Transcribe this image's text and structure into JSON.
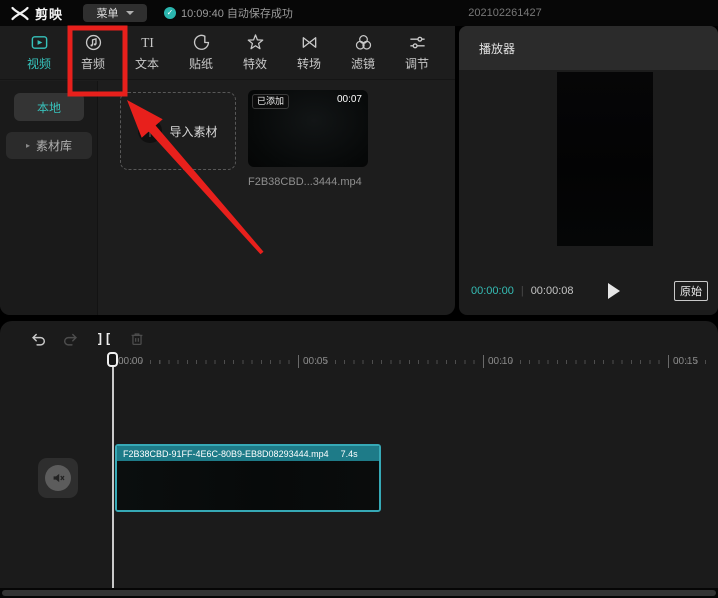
{
  "colors": {
    "accent": "#36c3bc",
    "annotation_red": "#e8201c",
    "clip_header_teal": "#1e7b88"
  },
  "topbar": {
    "app_name": "剪映",
    "menu_label": "菜单",
    "autosave_status": "10:09:40 自动保存成功",
    "project_name": "202102261427"
  },
  "toolbar": {
    "tabs": [
      {
        "label": "视频"
      },
      {
        "label": "音频"
      },
      {
        "label": "文本"
      },
      {
        "label": "贴纸"
      },
      {
        "label": "特效"
      },
      {
        "label": "转场"
      },
      {
        "label": "滤镜"
      },
      {
        "label": "调节"
      }
    ]
  },
  "sidebar": {
    "local_label": "本地",
    "library_label": "素材库"
  },
  "media": {
    "import_label": "导入素材",
    "card": {
      "badge": "已添加",
      "duration": "00:07",
      "name": "F2B38CBD...3444.mp4"
    }
  },
  "player": {
    "title": "播放器",
    "current_time": "00:00:00",
    "time_separator": "|",
    "total_time": "00:00:08",
    "original_label": "原始"
  },
  "timeline": {
    "ruler_labels": [
      "00:00",
      "00:05",
      "00:10",
      "00:15"
    ],
    "clip": {
      "name": "F2B38CBD-91FF-4E6C-80B9-EB8D08293444.mp4",
      "duration": "7.4s"
    }
  },
  "icons": {
    "autosave_check": "✓",
    "library_arrow": "▸",
    "split": "]["
  }
}
